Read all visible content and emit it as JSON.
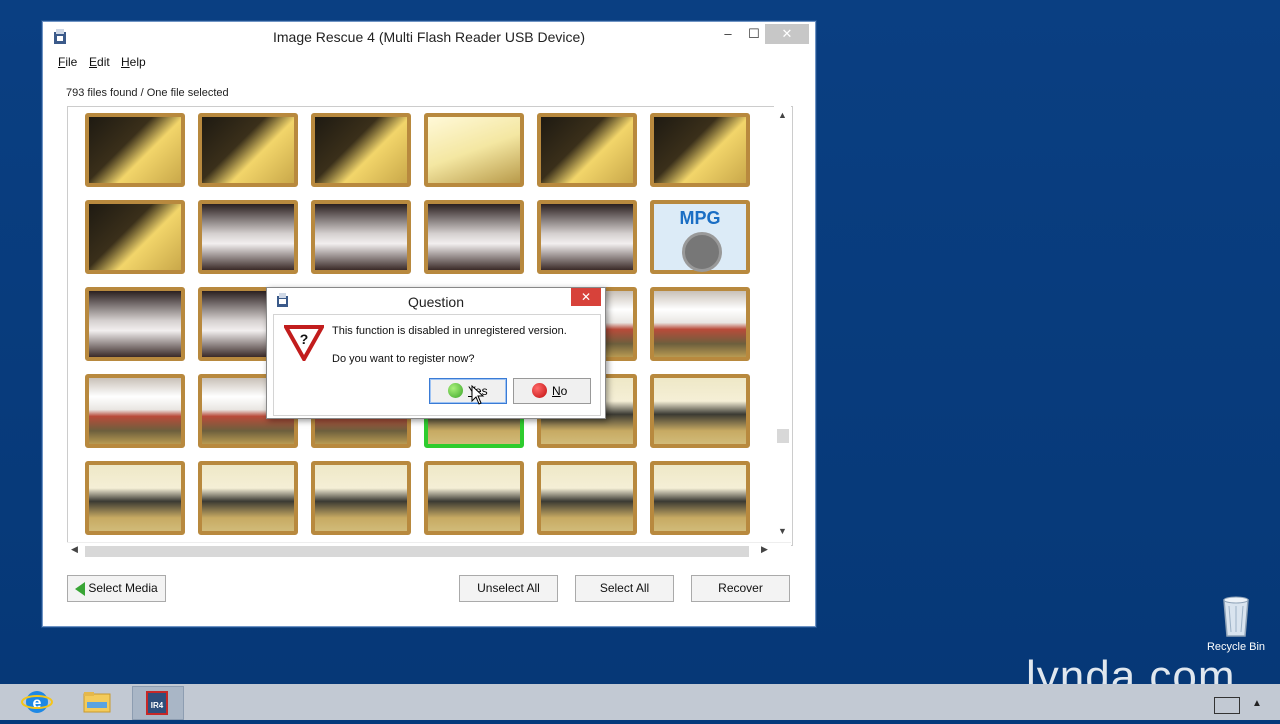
{
  "window": {
    "title": "Image Rescue 4 (Multi Flash Reader USB Device)",
    "minimize": "–",
    "maximize": "☐",
    "close": "✕"
  },
  "menu": {
    "file_first": "F",
    "file_rest": "ile",
    "edit_first": "E",
    "edit_rest": "dit",
    "help_first": "H",
    "help_rest": "elp"
  },
  "status": "793 files found / One file selected",
  "mpg_label": "MPG",
  "buttons": {
    "select_media": "Select Media",
    "unselect_all": "Unselect All",
    "select_all": "Select All",
    "recover": "Recover"
  },
  "dialog": {
    "title": "Question",
    "close": "✕",
    "message1": "This function is disabled in unregistered version.",
    "message2": "Do you want to register now?",
    "yes_first": "Y",
    "yes_rest": "es",
    "no_first": "N",
    "no_rest": "o"
  },
  "desktop": {
    "recycle_bin": "Recycle Bin",
    "watermark": "lynda.com"
  },
  "taskbar": {
    "items": [
      "internet-explorer",
      "file-explorer",
      "image-rescue"
    ]
  }
}
